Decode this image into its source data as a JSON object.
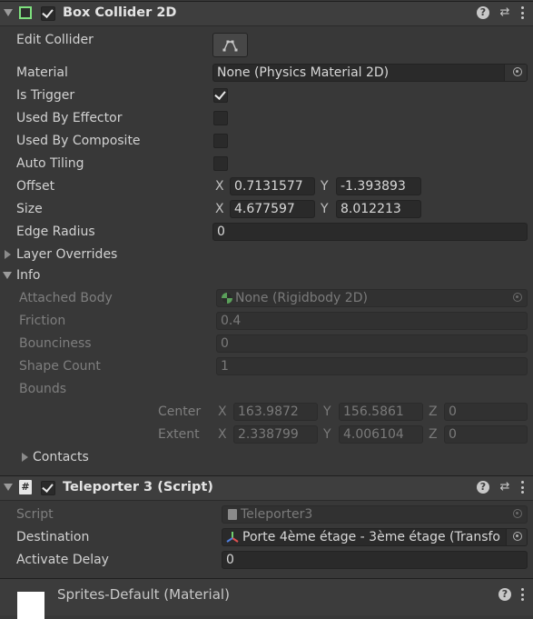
{
  "box_collider": {
    "title": "Box Collider 2D",
    "enabled": true,
    "edit_collider_label": "Edit Collider",
    "material_label": "Material",
    "material_value": "None (Physics Material 2D)",
    "is_trigger_label": "Is Trigger",
    "is_trigger": true,
    "used_by_effector_label": "Used By Effector",
    "used_by_effector": false,
    "used_by_composite_label": "Used By Composite",
    "used_by_composite": false,
    "auto_tiling_label": "Auto Tiling",
    "auto_tiling": false,
    "offset_label": "Offset",
    "offset": {
      "x_label": "X",
      "x": "0.7131577",
      "y_label": "Y",
      "y": "-1.393893"
    },
    "size_label": "Size",
    "size": {
      "x_label": "X",
      "x": "4.677597",
      "y_label": "Y",
      "y": "8.012213"
    },
    "edge_radius_label": "Edge Radius",
    "edge_radius": "0",
    "layer_overrides_label": "Layer Overrides",
    "info": {
      "label": "Info",
      "attached_body_label": "Attached Body",
      "attached_body_value": "None (Rigidbody 2D)",
      "friction_label": "Friction",
      "friction": "0.4",
      "bounciness_label": "Bounciness",
      "bounciness": "0",
      "shape_count_label": "Shape Count",
      "shape_count": "1",
      "bounds_label": "Bounds",
      "center_label": "Center",
      "center": {
        "x_label": "X",
        "x": "163.9872",
        "y_label": "Y",
        "y": "156.5861",
        "z_label": "Z",
        "z": "0"
      },
      "extent_label": "Extent",
      "extent": {
        "x_label": "X",
        "x": "2.338799",
        "y_label": "Y",
        "y": "4.006104",
        "z_label": "Z",
        "z": "0"
      },
      "contacts_label": "Contacts"
    }
  },
  "teleporter": {
    "title": "Teleporter 3 (Script)",
    "enabled": true,
    "script_label": "Script",
    "script_value": "Teleporter3",
    "destination_label": "Destination",
    "destination_value": "Porte 4ème étage - 3ème étage (Transfo",
    "activate_delay_label": "Activate Delay",
    "activate_delay": "0"
  },
  "material": {
    "title": "Sprites-Default (Material)"
  },
  "icons": [
    "collider-icon",
    "script-icon",
    "help-icon",
    "preset-icon",
    "kebab-menu-icon",
    "object-picker-icon",
    "edit-shape-icon",
    "transform-icon",
    "rigidbody-icon"
  ]
}
